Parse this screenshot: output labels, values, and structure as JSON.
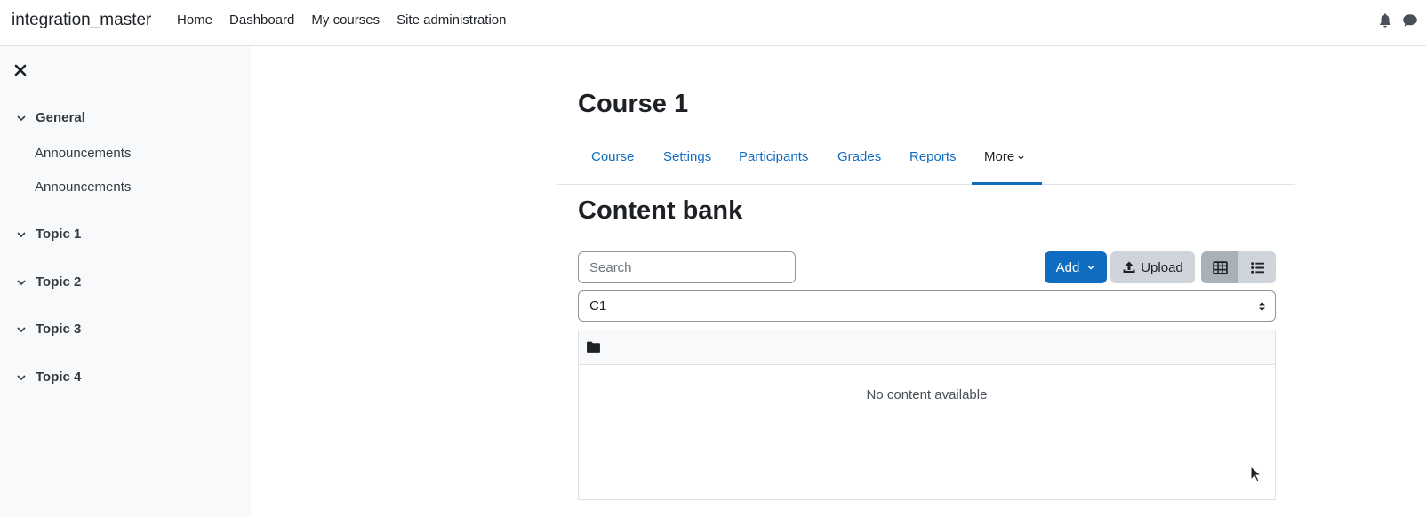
{
  "navbar": {
    "brand": "integration_master",
    "links": [
      "Home",
      "Dashboard",
      "My courses",
      "Site administration"
    ],
    "icons": [
      "bell-icon",
      "chat-icon"
    ]
  },
  "drawer": {
    "sections": [
      {
        "label": "General",
        "items": [
          "Announcements",
          "Announcements"
        ]
      },
      {
        "label": "Topic 1",
        "items": []
      },
      {
        "label": "Topic 2",
        "items": []
      },
      {
        "label": "Topic 3",
        "items": []
      },
      {
        "label": "Topic 4",
        "items": []
      }
    ]
  },
  "course": {
    "title": "Course 1",
    "tabs": [
      "Course",
      "Settings",
      "Participants",
      "Grades",
      "Reports",
      "More"
    ],
    "active_tab": "More"
  },
  "content_bank": {
    "title": "Content bank",
    "search_placeholder": "Search",
    "add_label": "Add",
    "upload_label": "Upload",
    "context_value": "C1",
    "empty_message": "No content available",
    "active_view": "grid"
  },
  "colors": {
    "primary": "#0f6cbf",
    "secondary_button": "#ced4da",
    "drawer_bg": "#f8f9fa"
  }
}
